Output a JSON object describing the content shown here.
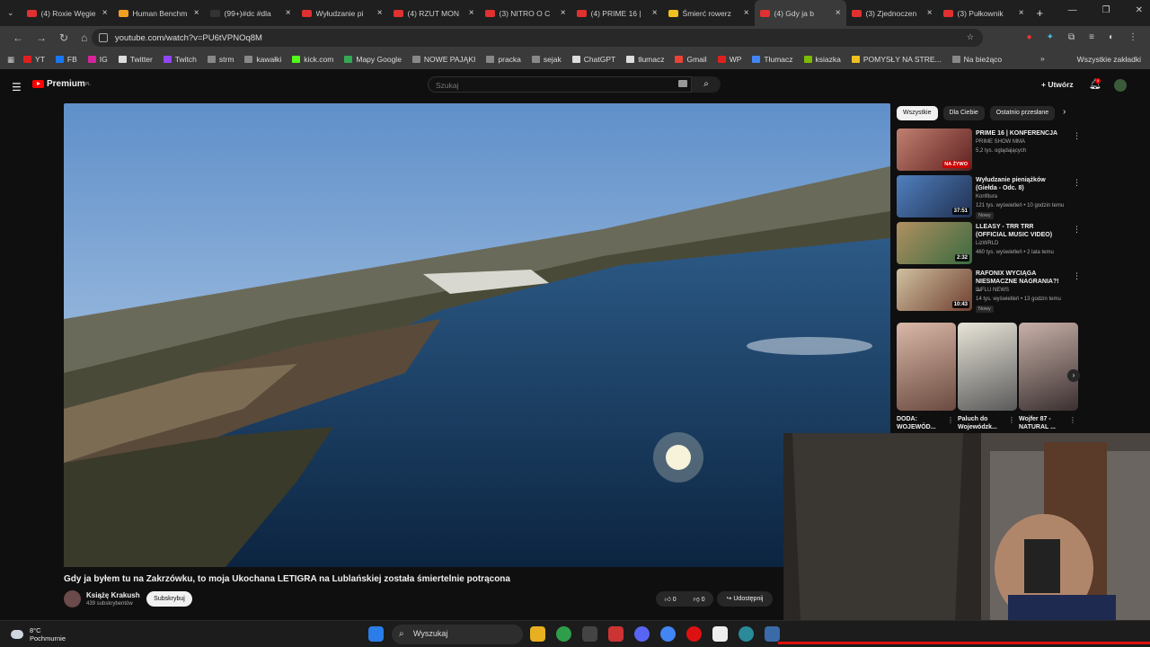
{
  "tabs": [
    {
      "title": "(4) Roxie Węgie",
      "color": "#e03030"
    },
    {
      "title": "Human Benchm",
      "color": "#f0a020"
    },
    {
      "title": "(99+)#dc #dla",
      "color": "#333"
    },
    {
      "title": "Wyłudzanie pi",
      "color": "#e03030"
    },
    {
      "title": "(4) RZUT MON",
      "color": "#e03030"
    },
    {
      "title": "(3) NITRO O C",
      "color": "#e03030"
    },
    {
      "title": "(4) PRIME 16 |",
      "color": "#e03030"
    },
    {
      "title": "Śmierć rowerz",
      "color": "#f0c020"
    },
    {
      "title": "(4) Gdy ja b",
      "color": "#e03030",
      "active": true
    },
    {
      "title": "(3) Zjednoczen",
      "color": "#e03030"
    },
    {
      "title": "(3) Pułkownik",
      "color": "#e03030"
    }
  ],
  "address": {
    "url": "youtube.com/watch?v=PU6tVPNOq8M"
  },
  "bookmarks": [
    {
      "label": "YT",
      "color": "#e02020"
    },
    {
      "label": "FB",
      "color": "#1877f2"
    },
    {
      "label": "IG",
      "color": "#d6249f"
    },
    {
      "label": "Twitter",
      "color": "#dddddd"
    },
    {
      "label": "Twitch",
      "color": "#9146ff"
    },
    {
      "label": "strm",
      "color": "#888888"
    },
    {
      "label": "kawałki",
      "color": "#888888"
    },
    {
      "label": "kick.com",
      "color": "#53fc18"
    },
    {
      "label": "Mapy Google",
      "color": "#34a853"
    },
    {
      "label": "NOWE PAJĄKI",
      "color": "#888888"
    },
    {
      "label": "pracka",
      "color": "#888888"
    },
    {
      "label": "sejak",
      "color": "#888888"
    },
    {
      "label": "ChatGPT",
      "color": "#dddddd"
    },
    {
      "label": "tłumacz",
      "color": "#dddddd"
    },
    {
      "label": "Gmail",
      "color": "#ea4335"
    },
    {
      "label": "WP",
      "color": "#e02020"
    },
    {
      "label": "Tłumacz",
      "color": "#4285f4"
    },
    {
      "label": "ksiazka",
      "color": "#7cbb00"
    },
    {
      "label": "POMYSŁY NA STRE...",
      "color": "#f0c020"
    },
    {
      "label": "Na bieżąco",
      "color": "#888888"
    }
  ],
  "bookmarks_right": "Wszystkie zakładki",
  "youtube": {
    "logo": "Premium",
    "logo_region": "PL",
    "search_placeholder": "Szukaj",
    "create_label": "Utwórz",
    "notif_count": "4"
  },
  "video": {
    "title": "Gdy ja byłem tu na Zakrzówku, to moja Ukochana LETIGRA na Lublańskiej została śmiertelnie potrącona",
    "channel": "Książę Krakush",
    "subscribers": "439 subskrybentów",
    "subscribe_label": "Subskrybuj",
    "likes": "0",
    "dislikes": "0",
    "share_label": "Udostępnij"
  },
  "chips": [
    "Wszystkie",
    "Dla Ciebie",
    "Ostatnio przesłane"
  ],
  "recommendations": [
    {
      "title": "PRIME 16 | KONFERENCJA",
      "channel": "PRIME SHOW MMA",
      "meta": "5,2 tys. oglądających",
      "duration": "NA ŻYWO",
      "is_live": true,
      "is_new": false
    },
    {
      "title": "Wyłudzanie pieniążków (Giełda - Odc. 8)",
      "channel": "Konfitura",
      "meta": "121 tys. wyświetleń • 10 godzin temu",
      "duration": "37:51",
      "is_live": false,
      "is_new": true
    },
    {
      "title": "LLEASY - TRR TRR (OFFICIAL MUSIC VIDEO)",
      "channel": "LizWRLD",
      "meta": "460 tys. wyświetleń • 2 lata temu",
      "duration": "2:32",
      "is_live": false,
      "is_new": false
    },
    {
      "title": "RAFONIX WYCIĄGA NIESMACZNE NAGRANIA?! ...",
      "channel": "INFLU NEWS",
      "meta": "14 tys. wyświetleń • 13 godzin temu",
      "duration": "10:43",
      "is_live": false,
      "is_new": true
    }
  ],
  "new_label": "Nowy",
  "shorts": [
    {
      "title": "DODA: WOJEWÓD..."
    },
    {
      "title": "Paluch do Wojewódzk..."
    },
    {
      "title": "Wojfer 87 - NATURAL ..."
    }
  ],
  "taskbar": {
    "temp": "8°C",
    "weather": "Pochmurnie",
    "search_label": "Wyszukaj"
  }
}
